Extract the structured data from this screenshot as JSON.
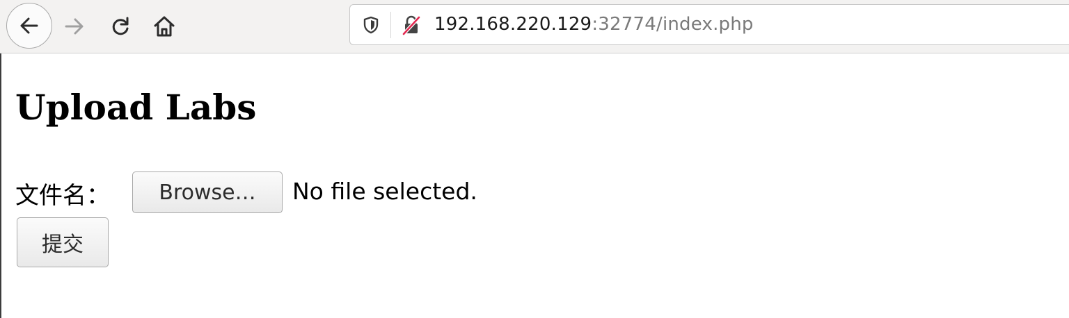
{
  "browser": {
    "url_host": "192.168.220.129",
    "url_rest": ":32774/index.php",
    "icons": {
      "back": "arrow-left-icon",
      "forward": "arrow-right-icon",
      "reload": "reload-icon",
      "home": "home-icon",
      "tracking": "shield-icon",
      "security": "insecure-lock-icon"
    },
    "colors": {
      "insecure_slash": "#e22850",
      "forward_disabled": "#a0a0a0"
    }
  },
  "page": {
    "title": "Upload Labs",
    "file_label": "文件名：",
    "browse_label": "Browse…",
    "file_status": "No file selected.",
    "submit_label": "提交"
  }
}
